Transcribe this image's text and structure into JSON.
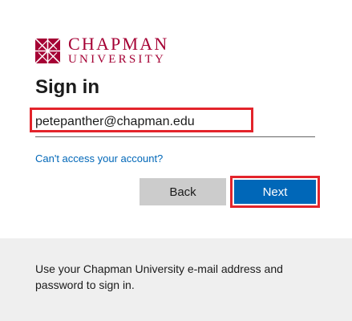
{
  "logo": {
    "line1": "CHAPMAN",
    "line2": "UNIVERSITY",
    "color": "#a50034"
  },
  "title": "Sign in",
  "email": {
    "value": "petepanther@chapman.edu"
  },
  "cant_access_link": "Can't access your account?",
  "buttons": {
    "back_label": "Back",
    "next_label": "Next"
  },
  "footer": {
    "text": "Use your Chapman University e-mail address and password to sign in."
  },
  "colors": {
    "accent": "#0067b8",
    "highlight": "#e3242b",
    "footer_bg": "#efefef"
  }
}
